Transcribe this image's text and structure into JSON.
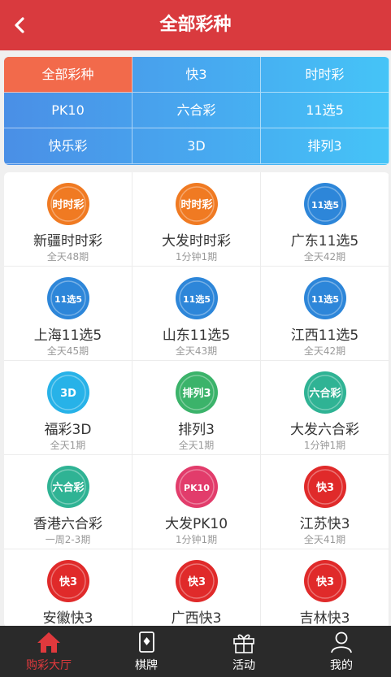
{
  "header": {
    "title": "全部彩种"
  },
  "categories": [
    {
      "label": "全部彩种",
      "active": true
    },
    {
      "label": "快3"
    },
    {
      "label": "时时彩"
    },
    {
      "label": "PK10"
    },
    {
      "label": "六合彩"
    },
    {
      "label": "11选5"
    },
    {
      "label": "快乐彩"
    },
    {
      "label": "3D"
    },
    {
      "label": "排列3"
    }
  ],
  "lotteries": [
    {
      "name": "新疆时时彩",
      "draws": "全天48期",
      "icon": "ssc-icon",
      "icon_text": "时时彩",
      "color": "#f07a22"
    },
    {
      "name": "大发时时彩",
      "draws": "1分钟1期",
      "icon": "ssc-icon",
      "icon_text": "时时彩",
      "color": "#f07a22"
    },
    {
      "name": "广东11选5",
      "draws": "全天42期",
      "icon": "11x5-icon",
      "icon_text": "11选5",
      "color": "#2d86d9"
    },
    {
      "name": "上海11选5",
      "draws": "全天45期",
      "icon": "11x5-icon",
      "icon_text": "11选5",
      "color": "#2d86d9"
    },
    {
      "name": "山东11选5",
      "draws": "全天43期",
      "icon": "11x5-icon",
      "icon_text": "11选5",
      "color": "#2d86d9"
    },
    {
      "name": "江西11选5",
      "draws": "全天42期",
      "icon": "11x5-icon",
      "icon_text": "11选5",
      "color": "#2d86d9"
    },
    {
      "name": "福彩3D",
      "draws": "全天1期",
      "icon": "3d-icon",
      "icon_text": "3D",
      "color": "#27b2e8"
    },
    {
      "name": "排列3",
      "draws": "全天1期",
      "icon": "pl3-icon",
      "icon_text": "排列3",
      "color": "#3bb36a"
    },
    {
      "name": "大发六合彩",
      "draws": "1分钟1期",
      "icon": "lhc-icon",
      "icon_text": "六合彩",
      "color": "#2fb394"
    },
    {
      "name": "香港六合彩",
      "draws": "一周2-3期",
      "icon": "lhc-icon",
      "icon_text": "六合彩",
      "color": "#2fb394"
    },
    {
      "name": "大发PK10",
      "draws": "1分钟1期",
      "icon": "pk10-icon",
      "icon_text": "PK10",
      "color": "#e23c6b"
    },
    {
      "name": "江苏快3",
      "draws": "全天41期",
      "icon": "k3-icon",
      "icon_text": "快3",
      "color": "#e02a2a"
    },
    {
      "name": "安徽快3",
      "draws": "",
      "icon": "k3-icon",
      "icon_text": "快3",
      "color": "#e02a2a"
    },
    {
      "name": "广西快3",
      "draws": "",
      "icon": "k3-icon",
      "icon_text": "快3",
      "color": "#e02a2a"
    },
    {
      "name": "吉林快3",
      "draws": "",
      "icon": "k3-icon",
      "icon_text": "快3",
      "color": "#e02a2a"
    }
  ],
  "nav": [
    {
      "label": "购彩大厅",
      "icon": "home-icon",
      "active": true
    },
    {
      "label": "棋牌",
      "icon": "cards-icon"
    },
    {
      "label": "活动",
      "icon": "gift-icon"
    },
    {
      "label": "我的",
      "icon": "user-icon"
    }
  ]
}
